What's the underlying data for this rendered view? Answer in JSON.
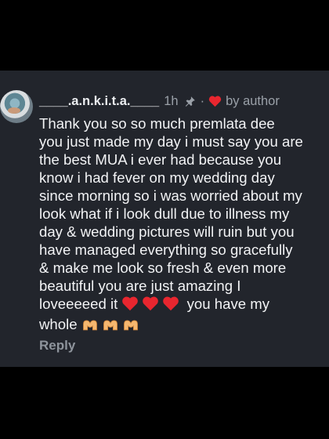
{
  "comment": {
    "username": "____.a.n.k.i.t.a.____",
    "time": "1h",
    "separator": "·",
    "author_label": "by author",
    "body_lines": [
      "Thank you so so much premlata dee",
      "you just made my day i must say you are",
      "the best MUA i ever had because you",
      "know i had fever on my wedding day",
      "since morning so i was worried about my",
      "look what if i look dull due to illness my",
      "day & wedding pictures will ruin but you",
      "have managed everything so gracefully",
      "& make me look so fresh & even more",
      "beautiful you are just amazing I"
    ],
    "line_11_text": "loveeeeed it",
    "line_11_after": "you have my",
    "line_12_text": "whole",
    "reply_label": "Reply"
  },
  "icons": {
    "pin": "pin-icon",
    "liked_by_author": "red-heart-icon",
    "body_hearts": "red-heart-emoji",
    "body_hands": "heart-hands-emoji"
  },
  "colors": {
    "background": "#000000",
    "card": "#22252c",
    "heart": "#e8262f",
    "meta_text": "#9aa0a8"
  }
}
